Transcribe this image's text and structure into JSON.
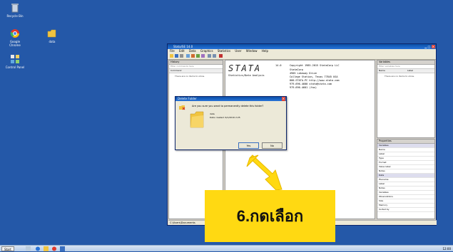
{
  "desktop": {
    "icons": [
      {
        "label": "Recycle Bin"
      },
      {
        "label": "Google Chrome"
      },
      {
        "label": "Control Panel"
      },
      {
        "label": "data"
      }
    ]
  },
  "stata": {
    "title": "Stata/SE 14.0",
    "menu": [
      "File",
      "Edit",
      "Data",
      "Graphics",
      "Statistics",
      "User",
      "Window",
      "Help"
    ],
    "history_title": "History",
    "history_search": "Filter commands here",
    "history_col": "Command",
    "history_empty": "There are no items to show.",
    "variables_title": "Variables",
    "variables_search": "Filter variables here",
    "variables_cols": [
      "Name",
      "Label"
    ],
    "variables_empty": "There are no items to show.",
    "properties_title": "Properties",
    "properties_rows": [
      "Variables",
      "Name",
      "Label",
      "Type",
      "Format",
      "Value label",
      "Notes",
      "Data",
      "Filename",
      "Label",
      "Notes",
      "Variables",
      "Observations",
      "Size",
      "Memory",
      "Sorted by"
    ],
    "results": {
      "logo": "STATA",
      "version": "14.0",
      "copyright": "Copyright 1985-2015 StataCorp LLC",
      "tagline": "Statistics/Data Analysis",
      "lines": [
        "StataCorp",
        "4905 Lakeway Drive",
        "College Station, Texas 77845 USA",
        "800-STATA-PC        http://www.stata.com",
        "979-696-4600        stata@stata.com",
        "979-696-4601 (fax)"
      ]
    },
    "status_path": "C:\\Users\\Documents"
  },
  "dialog": {
    "title": "Delete Folder",
    "question": "Are you sure you want to permanently delete this folder?",
    "folder_name": "data",
    "folder_date": "Date created: 6/1/2016 2:25",
    "yes_label": "Yes",
    "no_label": "No"
  },
  "callout": {
    "text": "6.กดเลือก"
  },
  "taskbar": {
    "start_label": "Start",
    "clock": "12:00"
  }
}
